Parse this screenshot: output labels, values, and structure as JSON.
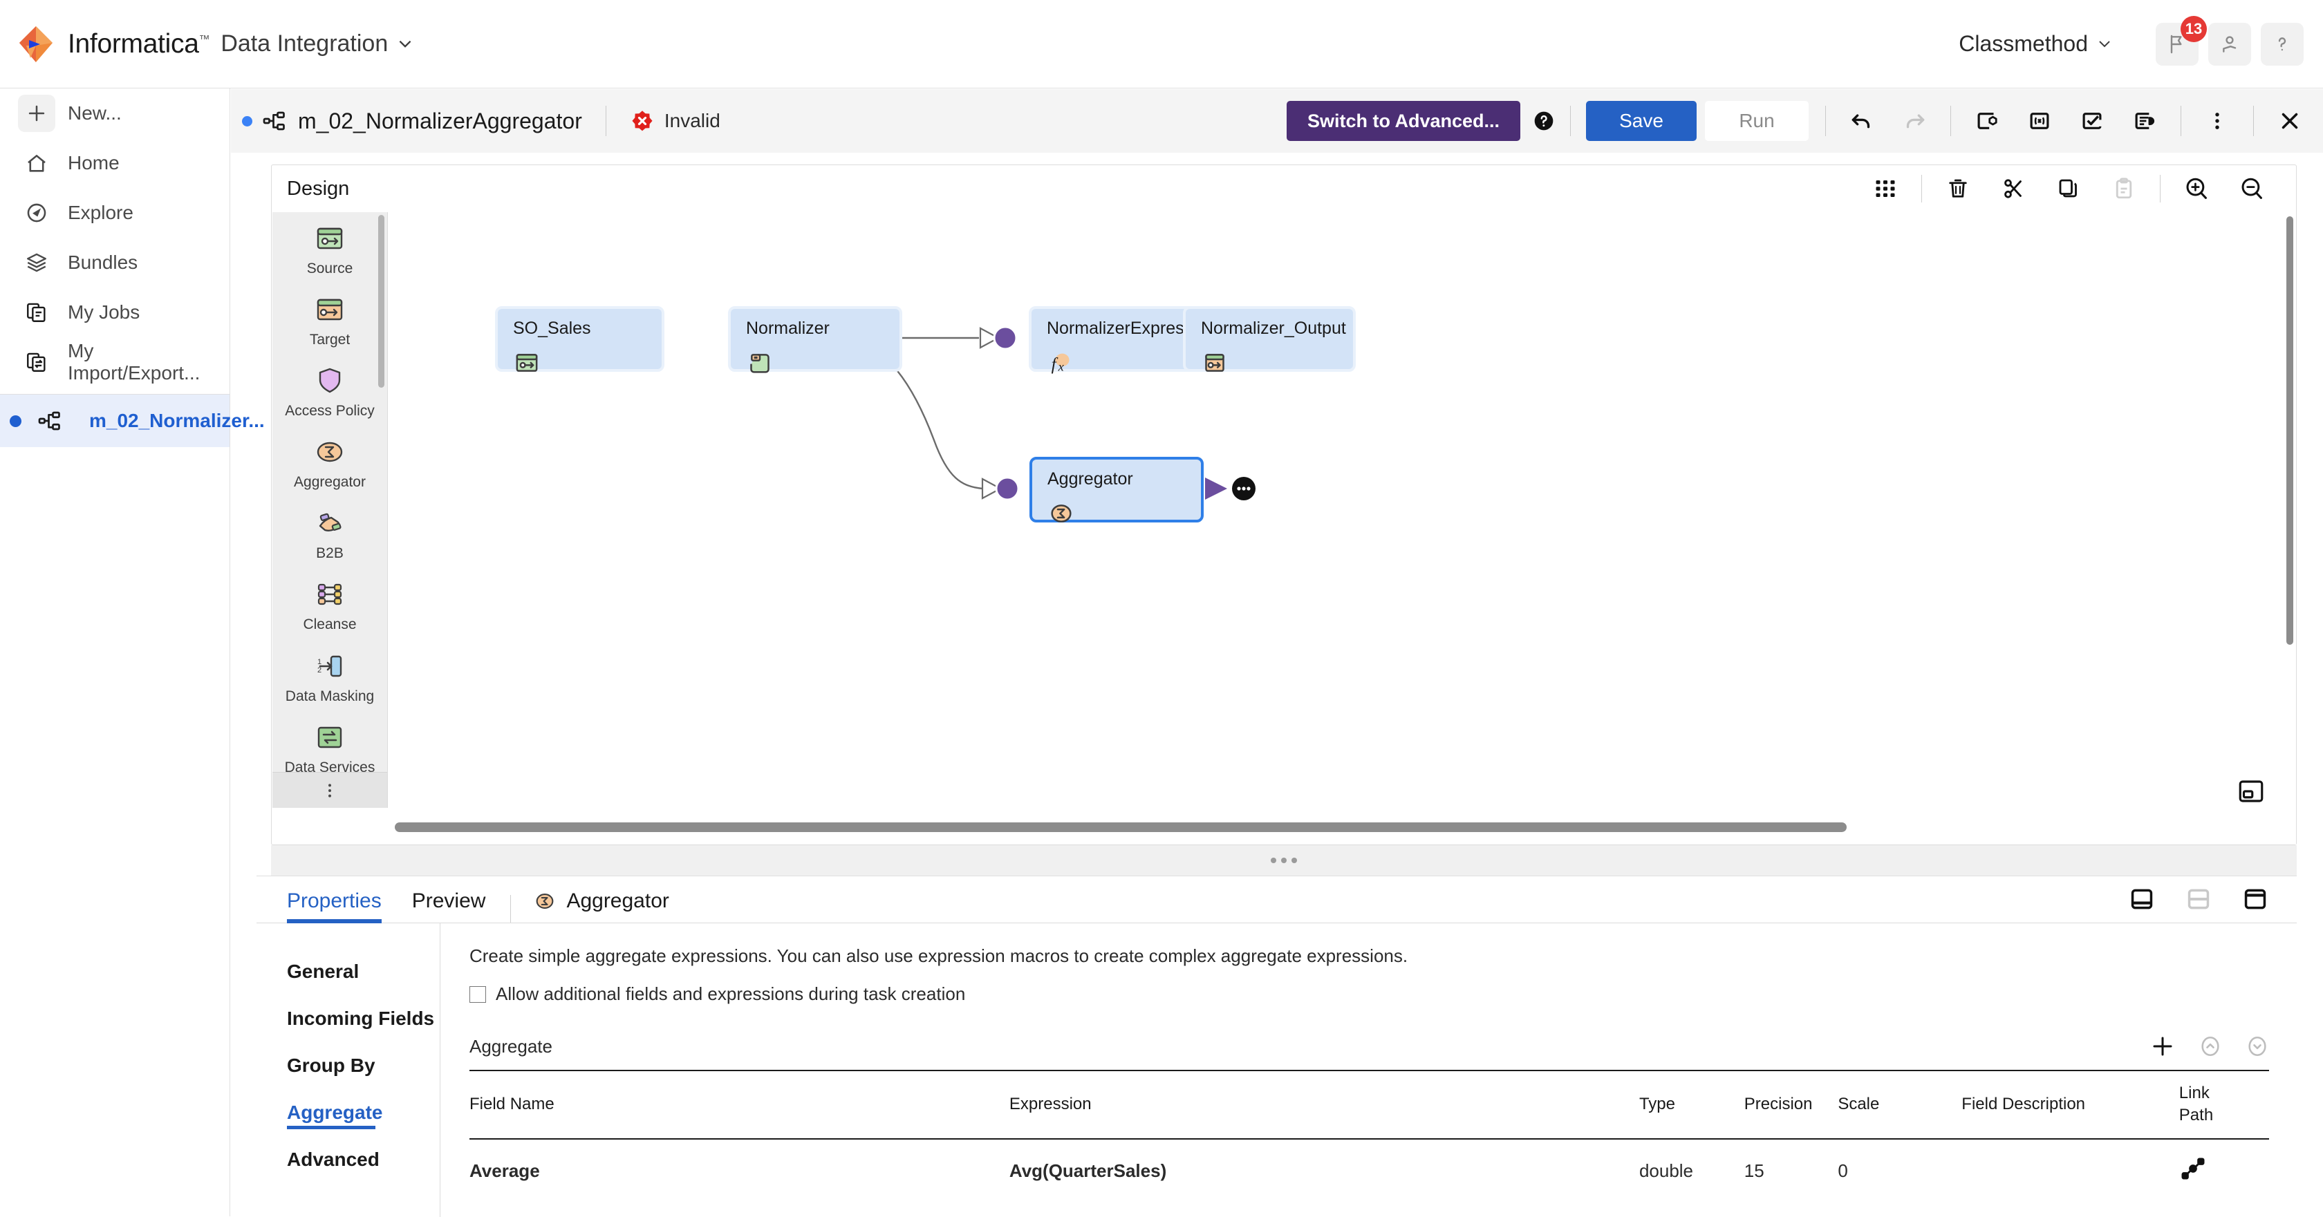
{
  "header": {
    "brand": "Informatica",
    "brand_tm": "™",
    "service": "Data Integration",
    "org": "Classmethod",
    "notification_count": "13",
    "icons": {
      "flag": "flag-icon",
      "user": "user-icon",
      "help": "help-icon"
    }
  },
  "sidebar": {
    "items": [
      {
        "label": "New...",
        "icon": "plus-icon",
        "name": "new"
      },
      {
        "label": "Home",
        "icon": "home-icon",
        "name": "home"
      },
      {
        "label": "Explore",
        "icon": "explore-icon",
        "name": "explore"
      },
      {
        "label": "Bundles",
        "icon": "bundles-icon",
        "name": "bundles"
      },
      {
        "label": "My Jobs",
        "icon": "jobs-icon",
        "name": "my-jobs"
      },
      {
        "label": "My Import/Export...",
        "icon": "import-export-icon",
        "name": "my-import-export"
      }
    ],
    "open_asset": {
      "label": "m_02_Normalizer...",
      "icon": "mapping-icon"
    }
  },
  "toolbar": {
    "mapping_title": "m_02_NormalizerAggregator",
    "status": "Invalid",
    "switch_advanced": "Switch to Advanced...",
    "save": "Save",
    "run": "Run",
    "icons": [
      "undo-icon",
      "redo-icon",
      "new-parameter-icon",
      "expression-macro-icon",
      "validate-icon",
      "mapping-summary-icon",
      "more-vertical-icon",
      "close-icon"
    ]
  },
  "design": {
    "title": "Design",
    "tools": [
      "grid-icon",
      "delete-icon",
      "cut-icon",
      "copy-icon",
      "paste-icon",
      "zoom-in-icon",
      "zoom-out-icon"
    ],
    "overview_icon": "overview-icon"
  },
  "palette": {
    "items": [
      {
        "label": "Source",
        "icon": "source-icon"
      },
      {
        "label": "Target",
        "icon": "target-icon"
      },
      {
        "label": "Access Policy",
        "icon": "access-policy-icon"
      },
      {
        "label": "Aggregator",
        "icon": "aggregator-icon"
      },
      {
        "label": "B2B",
        "icon": "b2b-icon"
      },
      {
        "label": "Cleanse",
        "icon": "cleanse-icon"
      },
      {
        "label": "Data Masking",
        "icon": "data-masking-icon"
      },
      {
        "label": "Data Services",
        "icon": "data-services-icon"
      },
      {
        "label": "",
        "icon": "business-rule-icon"
      }
    ],
    "more": "more-horizontal-icon"
  },
  "canvas": {
    "nodes": [
      {
        "id": "so_sales",
        "label": "SO_Sales",
        "icon": "source-icon",
        "selected": false
      },
      {
        "id": "normalizer",
        "label": "Normalizer",
        "icon": "normalizer-icon",
        "selected": false
      },
      {
        "id": "normalizerexpression",
        "label": "NormalizerExpression",
        "icon": "expression-icon",
        "selected": false
      },
      {
        "id": "normalizer_output",
        "label": "Normalizer_Output",
        "icon": "target-icon",
        "selected": false
      },
      {
        "id": "aggregator",
        "label": "Aggregator",
        "icon": "aggregator-icon",
        "selected": true
      }
    ]
  },
  "properties": {
    "tabs": [
      {
        "label": "Properties",
        "active": true
      },
      {
        "label": "Preview",
        "active": false
      }
    ],
    "object_label": "Aggregator",
    "object_icon": "aggregator-icon",
    "layout_icons": [
      "panel-bottom-icon",
      "panel-split-icon",
      "panel-top-icon"
    ],
    "side_items": [
      {
        "label": "General",
        "active": false
      },
      {
        "label": "Incoming Fields",
        "active": false
      },
      {
        "label": "Group By",
        "active": false
      },
      {
        "label": "Aggregate",
        "active": true
      },
      {
        "label": "Advanced",
        "active": false
      }
    ],
    "description": "Create simple aggregate expressions. You can also use expression macros to create complex aggregate expressions.",
    "allow_additional_label": "Allow additional fields and expressions during task creation",
    "allow_additional_checked": false,
    "section_title": "Aggregate",
    "section_tools": [
      "add-icon",
      "move-up-icon",
      "move-down-icon"
    ],
    "table": {
      "columns": [
        "Field Name",
        "Expression",
        "Type",
        "Precision",
        "Scale",
        "Field Description",
        "Link Path"
      ],
      "link_path_line1": "Link",
      "link_path_line2": "Path",
      "rows": [
        {
          "field_name": "Average",
          "expression": "Avg(QuarterSales)",
          "type": "double",
          "precision": "15",
          "scale": "0",
          "field_description": "",
          "link_path_icon": "link-path-icon"
        }
      ]
    }
  },
  "colors": {
    "brand_orange": "#E8663C",
    "accent_blue": "#2561C4",
    "advanced_purple": "#4B2E74",
    "invalid_red": "#E53935",
    "node_fill": "#D3E3F7",
    "port_purple": "#6B4E9E"
  }
}
